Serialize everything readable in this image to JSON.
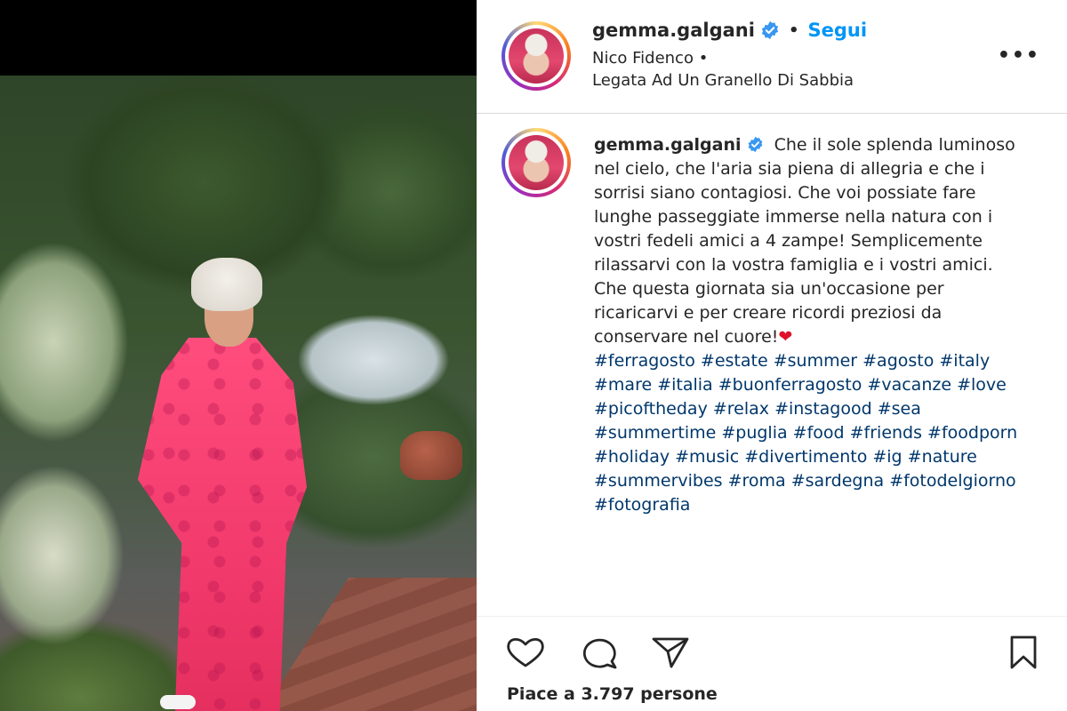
{
  "post": {
    "username": "gemma.galgani",
    "follow_label": "Segui",
    "music_artist": "Nico Fidenco",
    "music_song": "Legata Ad Un Granello Di Sabbia",
    "more_label": "•••"
  },
  "caption": {
    "username": "gemma.galgani",
    "text": "Che il sole splenda luminoso nel cielo, che l'aria sia piena di allegria e che i sorrisi siano contagiosi. Che voi possiate fare lunghe passeggiate immerse nella natura con i vostri fedeli amici a 4 zampe! Semplicemente rilassarvi con la vostra famiglia e i vostri amici. Che questa giornata sia un'occasione per ricaricarvi e per creare ricordi preziosi da conservare nel cuore!",
    "emoji": "❤",
    "hashtags": "#ferragosto #estate #summer #agosto #italy #mare #italia #buonferragosto #vacanze #love #picoftheday #relax #instagood #sea #summertime #puglia #food #friends #foodporn #holiday #music #divertimento #ig #nature #summervibes #roma #sardegna #fotodelgiorno #fotografia"
  },
  "likes": "Piace a 3.797 persone",
  "icons": {
    "like": "heart-icon",
    "comment": "comment-icon",
    "share": "send-icon",
    "save": "bookmark-icon",
    "verified": "verified-badge-icon"
  },
  "colors": {
    "follow": "#0095f6",
    "verified": "#3897f0",
    "hashtag": "#00376b",
    "dress": "#f23a6c"
  }
}
